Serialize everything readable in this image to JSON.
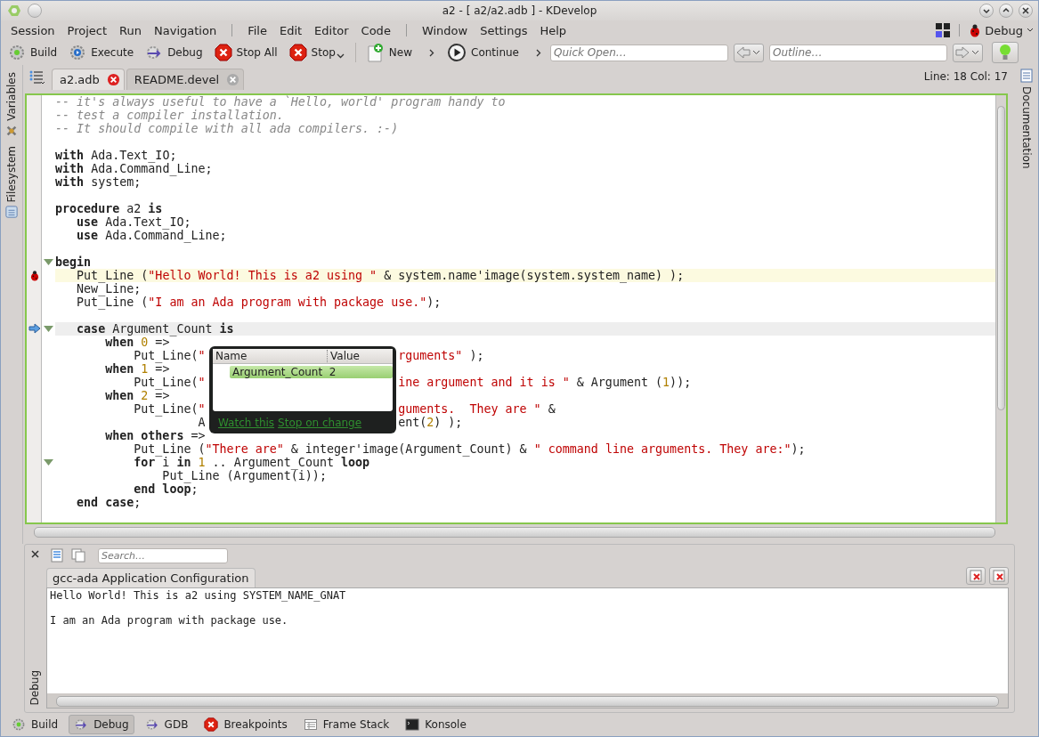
{
  "window": {
    "title": "a2 - [ a2/a2.adb ] - KDevelop"
  },
  "menu_groups": [
    [
      "Session",
      "Project",
      "Run",
      "Navigation"
    ],
    [
      "File",
      "Edit",
      "Editor",
      "Code"
    ],
    [
      "Window",
      "Settings",
      "Help"
    ]
  ],
  "area_switcher": {
    "label": "Debug"
  },
  "toolbar": [
    {
      "label": "Build",
      "kind": "build",
      "dropdown": false,
      "more": false
    },
    {
      "label": "Execute",
      "kind": "execute",
      "dropdown": false,
      "more": false
    },
    {
      "label": "Debug",
      "kind": "debug",
      "dropdown": false,
      "more": false
    },
    {
      "label": "Stop All",
      "kind": "stop",
      "dropdown": false,
      "more": false
    },
    {
      "label": "Stop",
      "kind": "stop",
      "dropdown": true,
      "more": false
    },
    {
      "label": "New",
      "kind": "new",
      "dropdown": false,
      "more": true
    },
    {
      "label": "Continue",
      "kind": "continue",
      "dropdown": false,
      "more": true
    }
  ],
  "quick_open": {
    "placeholder": "Quick Open…"
  },
  "outline": {
    "placeholder": "Outline…"
  },
  "left_dock": [
    {
      "label": "Variables",
      "kind": "variables"
    },
    {
      "label": "Filesystem",
      "kind": "filesystem"
    }
  ],
  "right_dock": [
    {
      "label": "Documentation"
    }
  ],
  "doc_tabs": [
    {
      "label": "a2.adb",
      "selected": true
    },
    {
      "label": "README.devel",
      "selected": false
    }
  ],
  "cursor_position": "Line: 18 Col: 17",
  "editor": {
    "lines": [
      {
        "fold": false,
        "breakpoint": false,
        "current": false,
        "tokens": [
          {
            "c": "-- it's always useful to have a `Hello, world' program handy to"
          }
        ]
      },
      {
        "fold": false,
        "breakpoint": false,
        "current": false,
        "tokens": [
          {
            "c": "-- test a compiler installation."
          }
        ]
      },
      {
        "fold": false,
        "breakpoint": false,
        "current": false,
        "tokens": [
          {
            "c": "-- It should compile with all ada compilers. :-)"
          }
        ]
      },
      {
        "fold": false,
        "breakpoint": false,
        "current": false
      },
      {
        "fold": false,
        "breakpoint": false,
        "current": false,
        "tokens": [
          {
            "k": "with"
          },
          {
            "t": " Ada.Text_IO;"
          }
        ]
      },
      {
        "fold": false,
        "breakpoint": false,
        "current": false,
        "tokens": [
          {
            "k": "with"
          },
          {
            "t": " Ada.Command_Line;"
          }
        ]
      },
      {
        "fold": false,
        "breakpoint": false,
        "current": false,
        "tokens": [
          {
            "k": "with"
          },
          {
            "t": " system;"
          }
        ]
      },
      {
        "fold": false,
        "breakpoint": false,
        "current": false
      },
      {
        "fold": false,
        "breakpoint": false,
        "current": false,
        "tokens": [
          {
            "k": "procedure"
          },
          {
            "t": " a2 "
          },
          {
            "k": "is"
          }
        ]
      },
      {
        "fold": false,
        "breakpoint": false,
        "current": false,
        "tokens": [
          {
            "k": "   use"
          },
          {
            "t": " Ada.Text_IO;"
          }
        ]
      },
      {
        "fold": false,
        "breakpoint": false,
        "current": false,
        "tokens": [
          {
            "k": "   use"
          },
          {
            "t": " Ada.Command_Line;"
          }
        ]
      },
      {
        "fold": false,
        "breakpoint": false,
        "current": false
      },
      {
        "fold": true,
        "breakpoint": false,
        "current": false,
        "tokens": [
          {
            "k": "begin"
          }
        ]
      },
      {
        "fold": false,
        "breakpoint": true,
        "current": false,
        "tokens": [
          {
            "t": "   Put_Line ("
          },
          {
            "s": "\"Hello World! This is a2 using \""
          },
          {
            "t": " & system.name'image(system.system_name) );"
          }
        ]
      },
      {
        "fold": false,
        "breakpoint": false,
        "current": false,
        "tokens": [
          {
            "t": "   New_Line;"
          }
        ]
      },
      {
        "fold": false,
        "breakpoint": false,
        "current": false,
        "tokens": [
          {
            "t": "   Put_Line ("
          },
          {
            "s": "\"I am an Ada program with package use.\""
          },
          {
            "t": ");"
          }
        ]
      },
      {
        "fold": false,
        "breakpoint": false,
        "current": false
      },
      {
        "fold": true,
        "breakpoint": false,
        "current": true,
        "tokens": [
          {
            "k": "   case"
          },
          {
            "t": " Argument_Count "
          },
          {
            "k": "is"
          }
        ]
      },
      {
        "fold": false,
        "breakpoint": false,
        "current": false,
        "tokens": [
          {
            "k": "       when"
          },
          {
            "n": " 0"
          },
          {
            "t": " =>"
          }
        ]
      },
      {
        "fold": false,
        "breakpoint": false,
        "current": false,
        "tokens": [
          {
            "t": "           Put_Line("
          },
          {
            "s": "\""
          }
        ],
        "after": [
          {
            "s": "rguments\""
          },
          {
            "t": " );"
          }
        ]
      },
      {
        "fold": false,
        "breakpoint": false,
        "current": false,
        "tokens": [
          {
            "k": "       when"
          },
          {
            "n": " 1"
          },
          {
            "t": " =>"
          }
        ]
      },
      {
        "fold": false,
        "breakpoint": false,
        "current": false,
        "tokens": [
          {
            "t": "           Put_Line("
          },
          {
            "s": "\""
          }
        ],
        "after": [
          {
            "s": "ine argument and it is \""
          },
          {
            "t": " & Argument ("
          },
          {
            "n": "1"
          },
          {
            "t": "));"
          }
        ]
      },
      {
        "fold": false,
        "breakpoint": false,
        "current": false,
        "tokens": [
          {
            "k": "       when"
          },
          {
            "n": " 2"
          },
          {
            "t": " =>"
          }
        ]
      },
      {
        "fold": false,
        "breakpoint": false,
        "current": false,
        "tokens": [
          {
            "t": "           Put_Line("
          },
          {
            "s": "\""
          }
        ],
        "after": [
          {
            "s": "guments.  They are \""
          },
          {
            "t": " &"
          }
        ]
      },
      {
        "fold": false,
        "breakpoint": false,
        "current": false,
        "tokens": [
          {
            "t": "                    A"
          }
        ],
        "after": [
          {
            "t": "ent("
          },
          {
            "n": "2"
          },
          {
            "t": ") );"
          }
        ]
      },
      {
        "fold": false,
        "breakpoint": false,
        "current": false,
        "tokens": [
          {
            "k": "       when others"
          },
          {
            "t": " =>"
          }
        ]
      },
      {
        "fold": false,
        "breakpoint": false,
        "current": false,
        "tokens": [
          {
            "t": "           Put_Line ("
          },
          {
            "s": "\"There are\""
          },
          {
            "t": " & integer'image(Argument_Count) & "
          },
          {
            "s": "\" command line arguments. They are:\""
          },
          {
            "t": ");"
          }
        ]
      },
      {
        "fold": true,
        "breakpoint": false,
        "current": false,
        "tokens": [
          {
            "k": "           for"
          },
          {
            "t": " i "
          },
          {
            "k": "in"
          },
          {
            "n": " 1"
          },
          {
            "t": " .. Argument_Count "
          },
          {
            "k": "loop"
          }
        ]
      },
      {
        "fold": false,
        "breakpoint": false,
        "current": false,
        "tokens": [
          {
            "t": "               Put_Line (Argument(i));"
          }
        ]
      },
      {
        "fold": false,
        "breakpoint": false,
        "current": false,
        "tokens": [
          {
            "k": "           end loop"
          },
          {
            "t": ";"
          }
        ]
      },
      {
        "fold": false,
        "breakpoint": false,
        "current": false,
        "tokens": [
          {
            "k": "   end case"
          },
          {
            "t": ";"
          }
        ]
      }
    ]
  },
  "variable_tooltip": {
    "columns": [
      "Name",
      "Value"
    ],
    "rows": [
      {
        "name": "Argument_Count",
        "value": "2",
        "selected": true
      }
    ],
    "links": [
      "Watch this",
      "Stop on change"
    ]
  },
  "output_panel": {
    "dock_title": "Debug",
    "search": {
      "placeholder": "Search…"
    },
    "tabs": [
      {
        "label": "gcc-ada Application Configuration",
        "selected": true
      }
    ],
    "text": "Hello World! This is a2 using SYSTEM_NAME_GNAT\n\nI am an Ada program with package use."
  },
  "bottom_tools": [
    {
      "label": "Build",
      "kind": "build",
      "selected": false
    },
    {
      "label": "Debug",
      "kind": "debug",
      "selected": true
    },
    {
      "label": "GDB",
      "kind": "debug",
      "selected": false
    },
    {
      "label": "Breakpoints",
      "kind": "stop",
      "selected": false
    },
    {
      "label": "Frame Stack",
      "kind": "table",
      "selected": false
    },
    {
      "label": "Konsole",
      "kind": "terminal",
      "selected": false
    }
  ]
}
